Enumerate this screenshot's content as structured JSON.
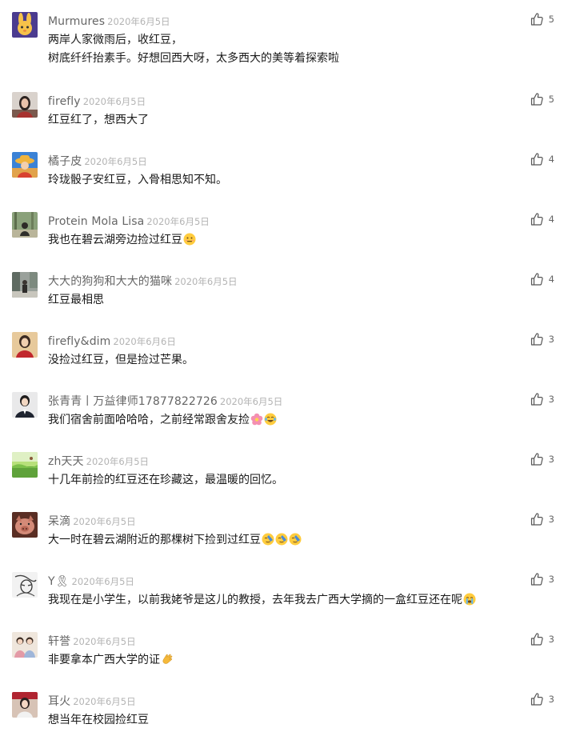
{
  "comments": [
    {
      "nick": "Murmures",
      "date": "2020年6月5日",
      "lines": [
        "两岸人家微雨后，收红豆，",
        "树底纤纤抬素手。好想回西大呀，太多西大的美等着探索啦"
      ],
      "likes": "5",
      "avatar": "cartoon-rabbit-avatar",
      "emoji": []
    },
    {
      "nick": "firefly",
      "date": "2020年6月5日",
      "lines": [
        "红豆红了，想西大了"
      ],
      "likes": "5",
      "avatar": "portrait-avatar",
      "emoji": []
    },
    {
      "nick": "橘子皮",
      "date": "2020年6月5日",
      "lines": [
        "玲珑骰子安红豆，入骨相思知不知。"
      ],
      "likes": "4",
      "avatar": "hat-person-avatar",
      "emoji": []
    },
    {
      "nick": "Protein  Mola Lisa",
      "date": "2020年6月5日",
      "lines": [
        "我也在碧云湖旁边捡过红豆"
      ],
      "likes": "4",
      "avatar": "outdoor-photo-avatar",
      "emoji": [
        "awkward-face-emoji"
      ]
    },
    {
      "nick": "大大的狗狗和大大的猫咪",
      "date": "2020年6月5日",
      "lines": [
        "红豆最相思"
      ],
      "likes": "4",
      "avatar": "street-photo-avatar",
      "emoji": []
    },
    {
      "nick": "firefly&dim",
      "date": "2020年6月6日",
      "lines": [
        "没捡过红豆，但是捡过芒果。"
      ],
      "likes": "3",
      "avatar": "red-scarf-avatar",
      "emoji": []
    },
    {
      "nick": "张青青丨万益律师17877822726",
      "date": "2020年6月5日",
      "lines": [
        "我们宿舍前面哈哈哈，之前经常跟舍友捡"
      ],
      "likes": "3",
      "avatar": "suit-portrait-avatar",
      "emoji": [
        "flower-emoji",
        "laugh-tears-emoji"
      ]
    },
    {
      "nick": "zh天天",
      "date": "2020年6月5日",
      "lines": [
        "十几年前捡的红豆还在珍藏这，最温暖的回忆。"
      ],
      "likes": "3",
      "avatar": "green-field-avatar",
      "emoji": []
    },
    {
      "nick": "呆滴",
      "date": "2020年6月5日",
      "lines": [
        "大一时在碧云湖附近的那棵树下捡到过红豆"
      ],
      "likes": "3",
      "avatar": "pig-avatar",
      "emoji": [
        "wipe-sweat-emoji",
        "wipe-sweat-emoji",
        "wipe-sweat-emoji"
      ]
    },
    {
      "nick": "Y🎗",
      "date": "2020年6月5日",
      "lines": [
        "我现在是小学生，以前我姥爷是这儿的教授，去年我去广西大学摘的一盒红豆还在呢"
      ],
      "likes": "3",
      "avatar": "sketch-avatar",
      "emoji": [
        "crying-emoji"
      ]
    },
    {
      "nick": "轩誉",
      "date": "2020年6月5日",
      "lines": [
        "非要拿本广西大学的证"
      ],
      "likes": "3",
      "avatar": "two-kids-avatar",
      "emoji": [
        "clapping-hands-emoji"
      ]
    },
    {
      "nick": "耳火",
      "date": "2020年6月5日",
      "lines": [
        "想当年在校园捡红豆"
      ],
      "likes": "3",
      "avatar": "girl-photo-avatar",
      "emoji": []
    }
  ]
}
